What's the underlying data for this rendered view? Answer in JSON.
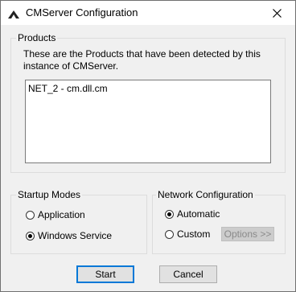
{
  "window": {
    "title": "CMServer Configuration",
    "icon": "app-icon",
    "close_glyph": "✕"
  },
  "products": {
    "legend": "Products",
    "description": "These are the Products that have been detected by this instance of CMServer.",
    "items": [
      "NET_2 - cm.dll.cm"
    ]
  },
  "startup": {
    "legend": "Startup Modes",
    "options": [
      {
        "label": "Application",
        "checked": false
      },
      {
        "label": "Windows Service",
        "checked": true
      }
    ]
  },
  "network": {
    "legend": "Network Configuration",
    "options": [
      {
        "label": "Automatic",
        "checked": true
      },
      {
        "label": "Custom",
        "checked": false
      }
    ],
    "options_button": "Options >>"
  },
  "buttons": {
    "start": "Start",
    "cancel": "Cancel"
  },
  "colors": {
    "accent": "#0078d7",
    "background": "#f0f0f0",
    "disabled_text": "#8a8a8a"
  }
}
